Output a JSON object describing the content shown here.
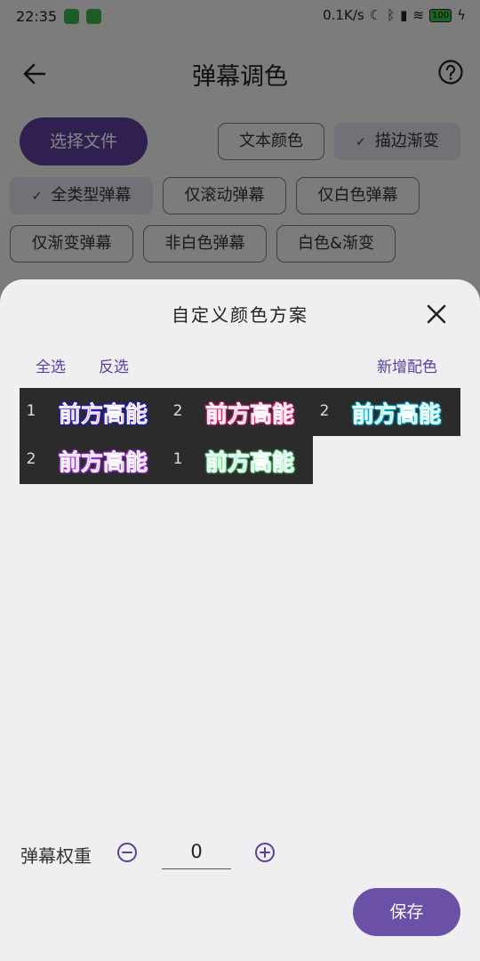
{
  "status": {
    "time": "22:35",
    "net_speed": "0.1K/s",
    "battery": "100"
  },
  "appbar": {
    "title": "弹幕调色"
  },
  "toolbar": {
    "pick_file": "选择文件"
  },
  "chips": [
    {
      "label": "文本颜色",
      "selected": false
    },
    {
      "label": "描边渐变",
      "selected": true
    },
    {
      "label": "全类型弹幕",
      "selected": true
    },
    {
      "label": "仅滚动弹幕",
      "selected": false
    },
    {
      "label": "仅白色弹幕",
      "selected": false
    },
    {
      "label": "仅渐变弹幕",
      "selected": false
    },
    {
      "label": "非白色弹幕",
      "selected": false
    },
    {
      "label": "白色&渐变",
      "selected": false
    }
  ],
  "sheet": {
    "title": "自定义颜色方案",
    "select_all": "全选",
    "invert": "反选",
    "add_color": "新增配色",
    "schemes": [
      {
        "num": "1",
        "text": "前方高能",
        "fill": "#ff2a2a",
        "stroke": "#ffffff",
        "glow": "#1a1aff"
      },
      {
        "num": "2",
        "text": "前方高能",
        "fill": "#ff6fb0",
        "stroke": "#ffffff",
        "glow": "#ff2a8a"
      },
      {
        "num": "2",
        "text": "前方高能",
        "fill": "#2aff5a",
        "stroke": "#ffffff",
        "glow": "#00c8ff"
      },
      {
        "num": "2",
        "text": "前方高能",
        "fill": "#6a7bff",
        "stroke": "#ffffff",
        "glow": "#c040ff"
      },
      {
        "num": "1",
        "text": "前方高能",
        "fill": "#3fd6ff",
        "stroke": "#ffffff",
        "glow": "#7dff9a"
      }
    ],
    "weight_label": "弹幕权重",
    "weight_value": "0",
    "save": "保存"
  }
}
